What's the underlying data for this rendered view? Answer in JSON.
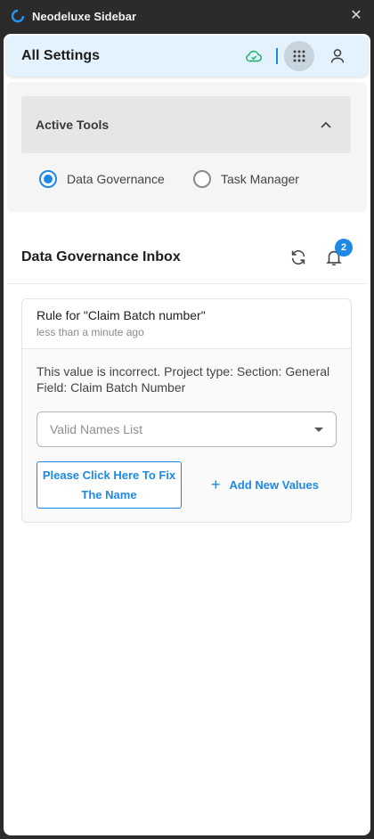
{
  "app": {
    "window_title": "Neodeluxe Sidebar"
  },
  "header": {
    "title": "All Settings"
  },
  "tools": {
    "title": "Active Tools",
    "options": [
      {
        "label": "Data Governance",
        "selected": true
      },
      {
        "label": "Task Manager",
        "selected": false
      }
    ]
  },
  "inbox": {
    "title": "Data Governance Inbox",
    "notification_count": "2",
    "card": {
      "title": "Rule for \"Claim Batch number\"",
      "time": "less than a minute ago",
      "message": "This value is incorrect. Project type: Section: General Field: Claim Batch Number",
      "select_placeholder": "Valid Names List",
      "fix_button": "Please Click Here To Fix The Name",
      "add_button": "Add New Values"
    }
  },
  "colors": {
    "accent": "#1e88e5",
    "header_bg": "#e3f2fc",
    "cloud": "#2bb673"
  }
}
